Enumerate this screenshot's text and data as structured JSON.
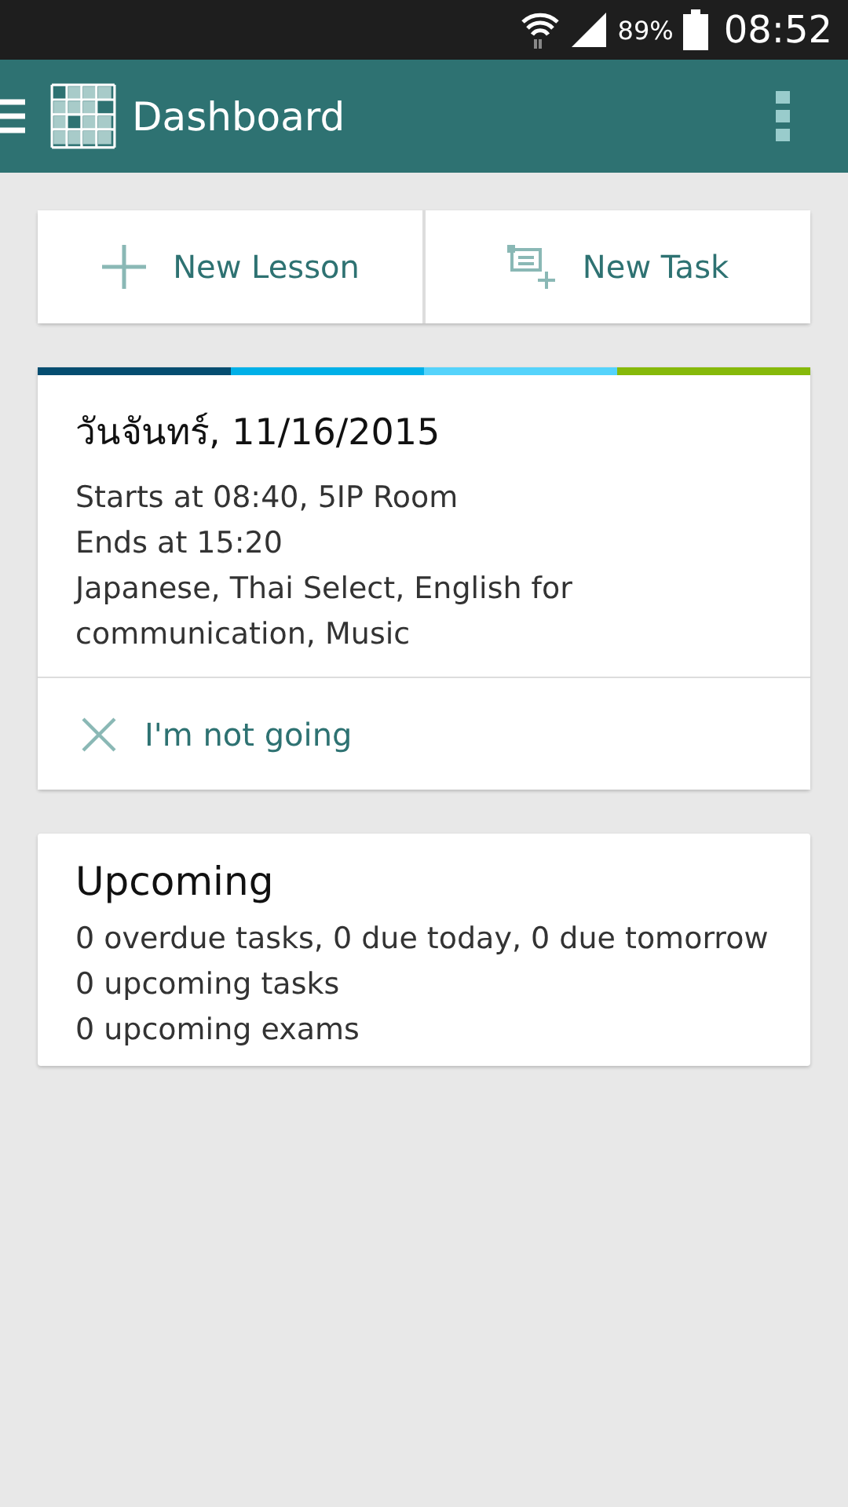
{
  "status_bar": {
    "battery": "89%",
    "time": "08:52"
  },
  "app_bar": {
    "title": "Dashboard"
  },
  "actions": [
    {
      "kind": "lesson",
      "label": "New Lesson"
    },
    {
      "kind": "task",
      "label": "New Task"
    }
  ],
  "day_card": {
    "stripes": [
      {
        "color": "#054d70"
      },
      {
        "color": "#00b0e8"
      },
      {
        "color": "#55d3fb"
      },
      {
        "color": "#86b90a"
      }
    ],
    "title": "วันจันทร์, 11/16/2015",
    "starts": "Starts at 08:40, 5IP Room",
    "ends": "Ends at 15:20",
    "subjects": "Japanese, Thai Select, English for communication, Music",
    "action": "I'm not going"
  },
  "upcoming": {
    "title": "Upcoming",
    "lines": [
      "0 overdue tasks, 0 due today, 0 due tomorrow",
      "0 upcoming tasks",
      "0 upcoming exams"
    ]
  }
}
